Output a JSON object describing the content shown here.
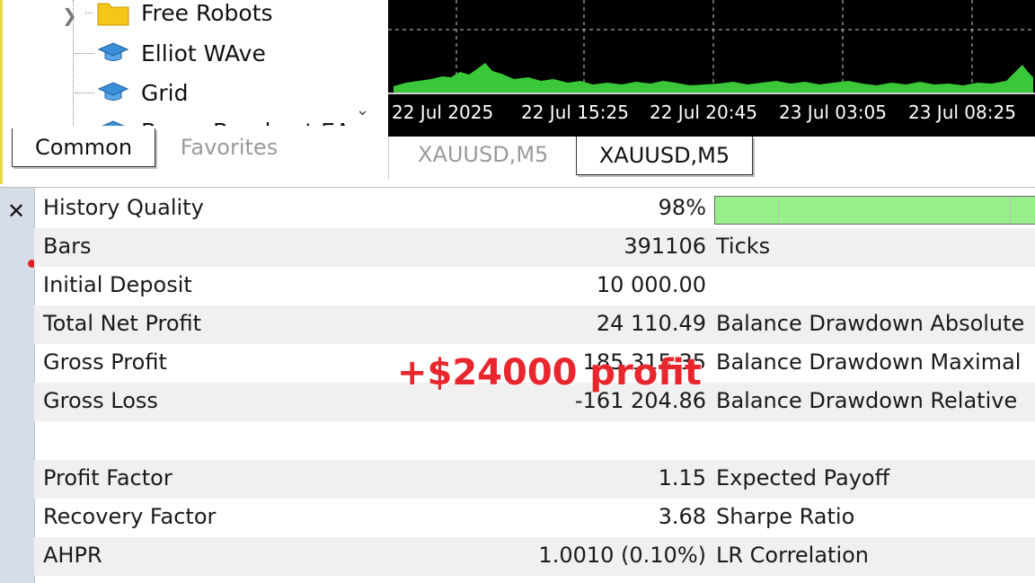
{
  "navigator": {
    "items": [
      {
        "label": "Free Robots",
        "icon": "folder-icon"
      },
      {
        "label": "Elliot WAve",
        "icon": "graduation-cap-icon"
      },
      {
        "label": "Grid",
        "icon": "graduation-cap-icon"
      },
      {
        "label": "Boom Breakout EA",
        "icon": "graduation-cap-icon"
      }
    ],
    "tabs": {
      "common": "Common",
      "favorites": "Favorites"
    }
  },
  "chart": {
    "time_labels": [
      "22 Jul 2025",
      "22 Jul 15:25",
      "22 Jul 20:45",
      "23 Jul 03:05",
      "23 Jul 08:25"
    ],
    "tabs": [
      "XAUUSD,M5",
      "XAUUSD,M5"
    ],
    "colors": {
      "background": "#000000",
      "volume": "#3ac83a",
      "grid": "#ffffff"
    }
  },
  "report": {
    "rows": [
      {
        "label": "History Quality",
        "value": "98%",
        "label2": "",
        "bar_fraction": 0.98
      },
      {
        "label": "Bars",
        "value": "391106",
        "label2": "Ticks"
      },
      {
        "label": "Initial Deposit",
        "value": "10 000.00",
        "label2": ""
      },
      {
        "label": "Total Net Profit",
        "value": "24 110.49",
        "label2": "Balance Drawdown Absolute"
      },
      {
        "label": "Gross Profit",
        "value": "185 315.35",
        "label2": "Balance Drawdown Maximal"
      },
      {
        "label": "Gross Loss",
        "value": "-161 204.86",
        "label2": "Balance Drawdown Relative"
      },
      {
        "label": "",
        "value": "",
        "label2": ""
      },
      {
        "label": "Profit Factor",
        "value": "1.15",
        "label2": "Expected Payoff"
      },
      {
        "label": "Recovery Factor",
        "value": "3.68",
        "label2": "Sharpe Ratio"
      },
      {
        "label": "AHPR",
        "value": "1.0010 (0.10%)",
        "label2": "LR Correlation"
      }
    ]
  },
  "overlay": {
    "text": "+$24000 profit",
    "color": "#e8262d"
  }
}
